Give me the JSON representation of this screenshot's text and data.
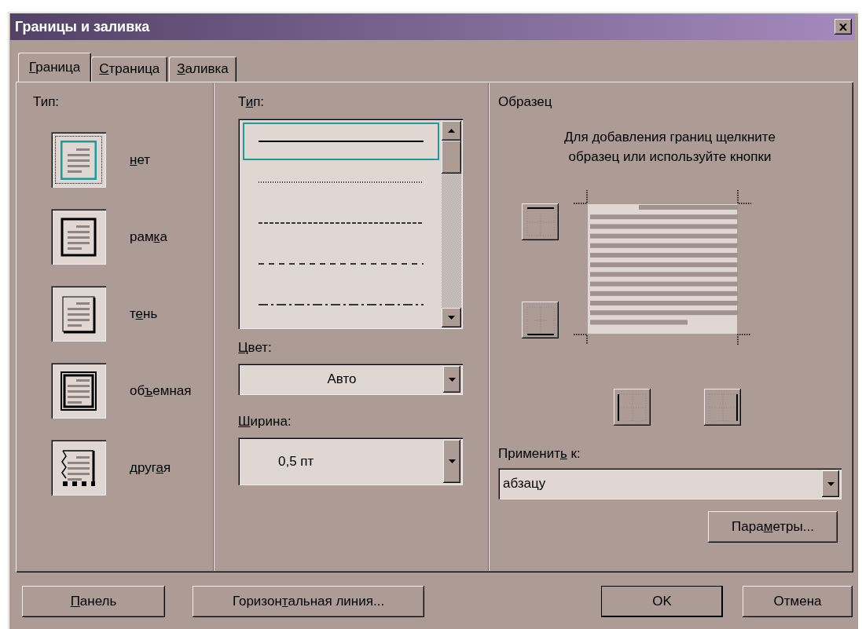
{
  "window": {
    "title": "Границы и заливка"
  },
  "tabs": [
    {
      "label": {
        "key": "Г",
        "post": "раница"
      },
      "selected": true
    },
    {
      "label": {
        "key": "С",
        "post": "траница"
      },
      "selected": false
    },
    {
      "label": {
        "key": "З",
        "post": "аливка"
      },
      "selected": false
    }
  ],
  "border_type": {
    "heading": "Тип:",
    "options": [
      {
        "kind": "none",
        "label": {
          "key": "н",
          "post": "ет"
        },
        "selected": true
      },
      {
        "kind": "box",
        "label": {
          "pre": "рам",
          "key": "к",
          "post": "а"
        },
        "selected": false
      },
      {
        "kind": "shadow",
        "label": {
          "pre": "т",
          "key": "е",
          "post": "нь"
        },
        "selected": false
      },
      {
        "kind": "raised",
        "label": {
          "pre": "об",
          "key": "ъ",
          "post": "емная"
        },
        "selected": false
      },
      {
        "kind": "custom",
        "label": {
          "pre": "друг",
          "key": "а",
          "post": "я"
        },
        "selected": false
      }
    ]
  },
  "line_style": {
    "heading": {
      "pre": "Т",
      "key": "и",
      "post": "п:"
    },
    "options": [
      {
        "kind": "solid",
        "selected": true
      },
      {
        "kind": "dotted",
        "selected": false
      },
      {
        "kind": "dashed",
        "selected": false
      },
      {
        "kind": "dashed-long",
        "selected": false
      },
      {
        "kind": "dash-dot",
        "selected": false
      }
    ]
  },
  "color": {
    "label": {
      "key": "Ц",
      "post": "вет:"
    },
    "value": "Авто"
  },
  "width": {
    "label": {
      "key": "Ш",
      "post": "ирина:"
    },
    "value": "0,5 пт"
  },
  "preview": {
    "heading": "Образец",
    "instruction": [
      "Для добавления границ щелкните",
      "образец или используйте кнопки"
    ],
    "border_buttons": [
      {
        "kind": "top"
      },
      {
        "kind": "bottom"
      },
      {
        "kind": "left"
      },
      {
        "kind": "right"
      }
    ]
  },
  "apply_to": {
    "label": {
      "pre": "Применит",
      "key": "ь",
      "post": " к:"
    },
    "value": "абзацу"
  },
  "options_button": {
    "pre": "Пара",
    "key": "м",
    "post": "етры..."
  },
  "buttons": [
    {
      "kind": "left",
      "label": {
        "key": "П",
        "post": "анель"
      }
    },
    {
      "kind": "left",
      "label": {
        "pre": "Горизон",
        "key": "т",
        "post": "альная линия..."
      }
    },
    {
      "kind": "ok",
      "label": {
        "pre": "OK"
      }
    },
    {
      "kind": "cancel",
      "label": {
        "pre": "Отмена"
      }
    }
  ]
}
